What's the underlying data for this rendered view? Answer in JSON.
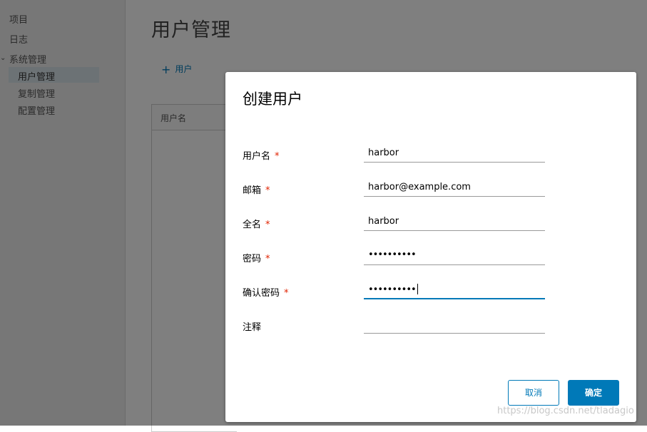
{
  "sidebar": {
    "items": [
      {
        "label": "项目"
      },
      {
        "label": "日志"
      },
      {
        "label": "系统管理"
      },
      {
        "label": "用户管理"
      },
      {
        "label": "复制管理"
      },
      {
        "label": "配置管理"
      }
    ]
  },
  "main": {
    "title": "用户管理",
    "add_user_label": "用户",
    "table": {
      "columns": [
        "用户名"
      ]
    }
  },
  "modal": {
    "title": "创建用户",
    "required_mark": "*",
    "fields": {
      "username": {
        "label": "用户名",
        "value": "harbor"
      },
      "email": {
        "label": "邮箱",
        "value": "harbor@example.com"
      },
      "fullname": {
        "label": "全名",
        "value": "harbor"
      },
      "password": {
        "label": "密码",
        "value": "••••••••••"
      },
      "confirm_password": {
        "label": "确认密码",
        "value": "••••••••••"
      },
      "comment": {
        "label": "注释",
        "value": ""
      }
    },
    "cancel_label": "取消",
    "ok_label": "确定"
  },
  "watermark": "https://blog.csdn.net/tladagio",
  "colors": {
    "accent": "#0079b8",
    "required": "#e12200"
  }
}
